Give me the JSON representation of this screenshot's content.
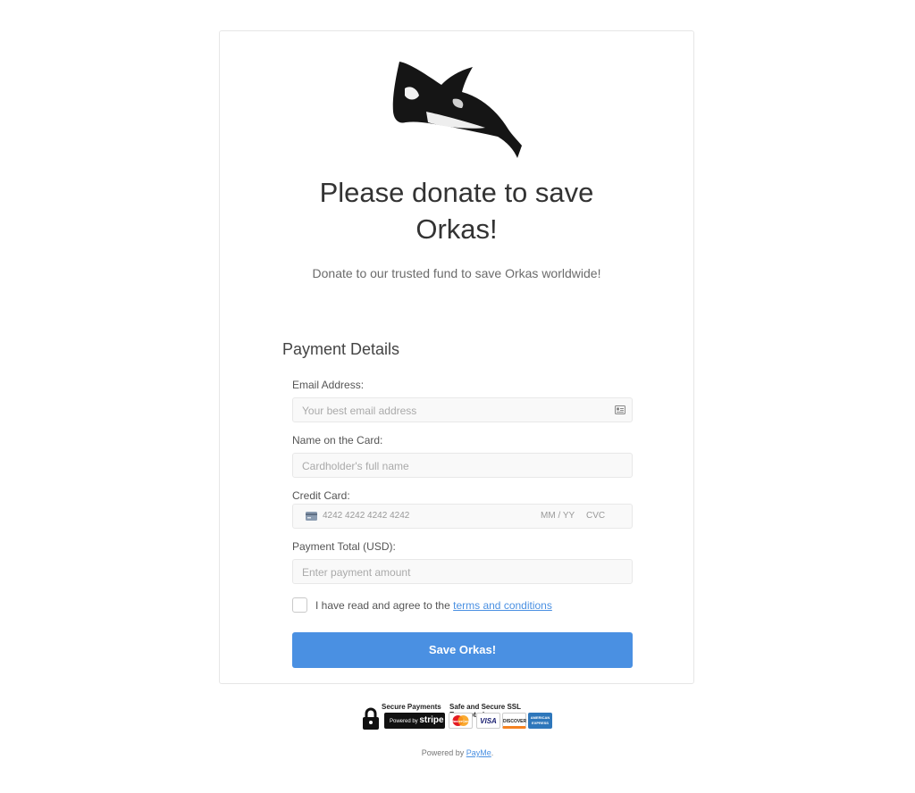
{
  "header": {
    "title": "Please donate to save Orkas!",
    "subtitle": "Donate to our trusted fund to save Orkas worldwide!"
  },
  "form": {
    "section_title": "Payment Details",
    "email": {
      "label": "Email Address:",
      "placeholder": "Your best email address"
    },
    "name": {
      "label": "Name on the Card:",
      "placeholder": "Cardholder's full name"
    },
    "card": {
      "label": "Credit Card:",
      "number_placeholder": "4242 4242 4242 4242",
      "expiry_placeholder": "MM / YY",
      "cvc_placeholder": "CVC"
    },
    "amount": {
      "label": "Payment Total (USD):",
      "placeholder": "Enter payment amount"
    },
    "terms": {
      "prefix": "I have read and agree to the",
      "link_text": "terms and conditions",
      "checked": false
    },
    "submit_label": "Save Orkas!"
  },
  "badges": {
    "secure_payments": "Secure Payments",
    "powered_by": "Powered by",
    "stripe": "stripe",
    "ssl": "Safe and Secure SSL Encrypted",
    "cards": [
      "MasterCard",
      "VISA",
      "DISCOVER",
      "AMERICAN EXPRESS"
    ]
  },
  "footer": {
    "prefix": "Powered by",
    "link": "PayMe",
    "suffix": "."
  },
  "colors": {
    "accent": "#4a90e2",
    "border": "#e6e6e6",
    "field_bg": "#f9f9f9"
  },
  "icons": {
    "logo": "orca-logo",
    "email_field": "id-card-icon",
    "card_field": "credit-card-icon",
    "badge": "lock-icon"
  }
}
